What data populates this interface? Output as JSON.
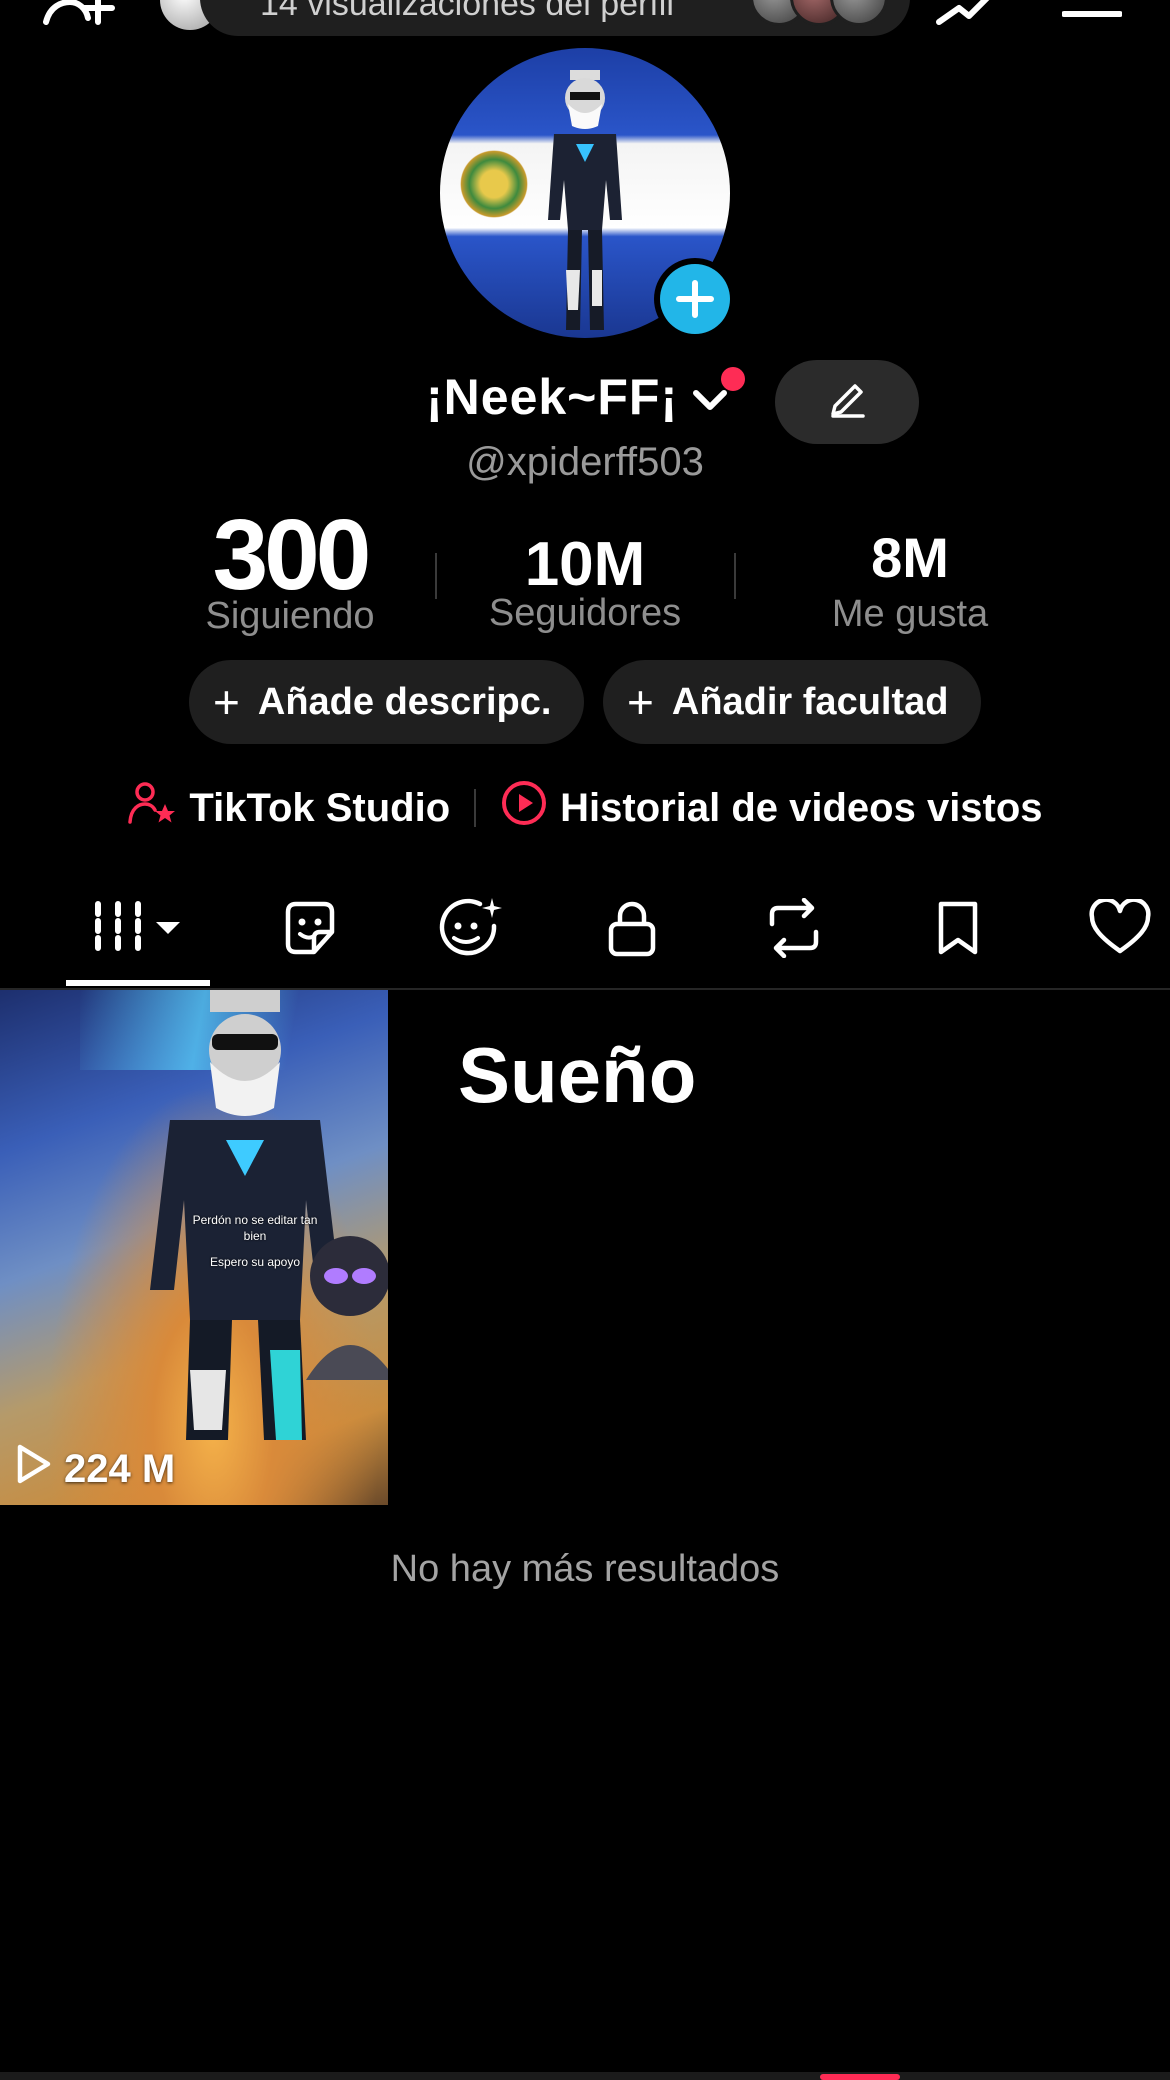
{
  "top_bar": {
    "views_text": "14 visualizaciones del perfil"
  },
  "profile": {
    "display_name": "¡Neek~FF¡",
    "username": "@xpiderff503"
  },
  "stats": {
    "following_value": "300",
    "following_label": "Siguiendo",
    "followers_value": "10M",
    "followers_label": "Seguidores",
    "likes_value": "8M",
    "likes_label": "Me gusta"
  },
  "actions": {
    "add_description": "Añade descripc.",
    "add_faculty": "Añadir facultad"
  },
  "links": {
    "studio": "TikTok Studio",
    "history": "Historial de videos vistos"
  },
  "tabs": [
    "videos",
    "stickers",
    "ai-effects",
    "private",
    "reposts",
    "saved",
    "liked"
  ],
  "grid": {
    "video_views": "224 M",
    "video_caption_line1": "Perdón no se editar tan",
    "video_caption_line2": "bien",
    "video_caption_line3": "Espero su apoyo",
    "playlist_title": "Sueño",
    "end_message": "No hay más resultados"
  },
  "colors": {
    "background": "#000000",
    "accent_red": "#fe2c55",
    "badge_blue": "#22b6e8",
    "chip_bg": "#1f1f1f"
  }
}
